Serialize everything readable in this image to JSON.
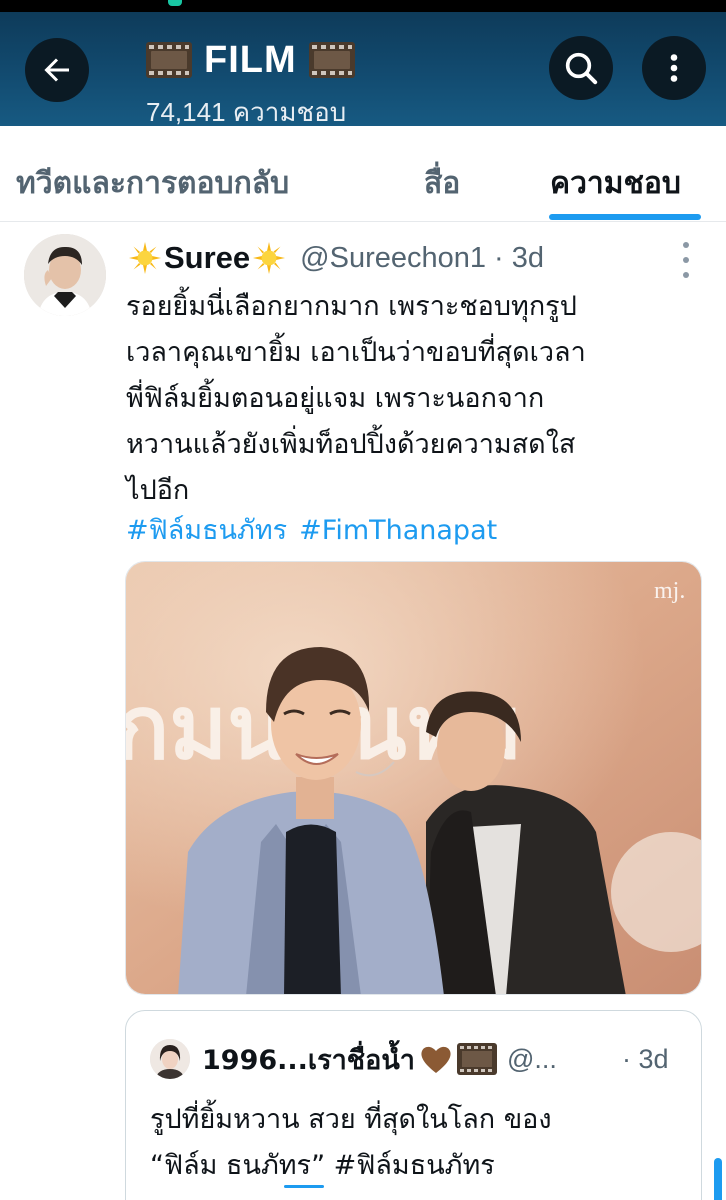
{
  "header": {
    "title": "FILM",
    "likes_count": "74,141",
    "likes_label": "ความชอบ",
    "icons": {
      "back": "arrow-left-icon",
      "search": "search-icon",
      "more": "more-vertical-icon",
      "title_decoration": "film-frames-icon"
    }
  },
  "tabs": [
    {
      "label": "ทวีตและการตอบกลับ",
      "selected": false
    },
    {
      "label": "สื่อ",
      "selected": false
    },
    {
      "label": "ความชอบ",
      "selected": true
    }
  ],
  "tweet": {
    "display_name": "Suree",
    "name_decoration": "sun-emoji-icon",
    "handle": "@Sureechon1",
    "separator": "·",
    "time": "3d",
    "body_lines": [
      "รอยยิ้มนี่เลือกยากมาก เพราะชอบทุกรูป",
      "เวลาคุณเขายิ้ม เอาเป็นว่าขอบที่สุดเวลา",
      "พี่ฟิล์มยิ้มตอนอยู่แจม เพราะนอกจาก",
      "หวานแล้วยังเพิ่มท็อปปิ้งด้วยความสดใส",
      "ไปอีก"
    ],
    "hashtags": [
      "#ฟิล์มธนภัทร",
      "#FimThanapat"
    ],
    "media": {
      "watermark": "mj.",
      "backdrop_text": "กมนคนหม"
    }
  },
  "quoted_tweet": {
    "display_name": "1996...เราชื่อน้ำ",
    "handle": "@...",
    "separator": "·",
    "time": "3d",
    "icons": [
      "brown-heart-icon",
      "film-frames-icon"
    ],
    "body_lines": [
      "รูปที่ยิ้มหวาน สวย ที่สุดในโลก ของ",
      "“ฟิล์ม ธนภัทร” #ฟิล์มธนภัทร"
    ]
  },
  "colors": {
    "header_bg": "#124b70",
    "accent": "#1d9bf0",
    "muted_text": "#536471",
    "primary_text": "#0f1419"
  }
}
